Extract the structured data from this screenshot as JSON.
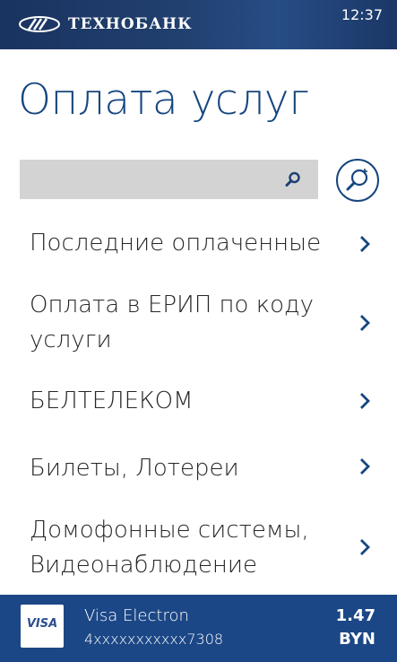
{
  "status_bar": {
    "bank_name": "ТЕХНОБАНК",
    "time": "12:37",
    "icons": [
      "bank-logo-icon"
    ]
  },
  "page": {
    "title": "Оплата услуг"
  },
  "search": {
    "value": "",
    "placeholder": "",
    "search_icon": "search-icon",
    "advanced_search_icon": "advanced-search-icon"
  },
  "menu": {
    "items": [
      {
        "label": "Последние оплаченные",
        "icon": "chevron-right-icon"
      },
      {
        "label": "Оплата в ЕРИП по коду услуги",
        "icon": "chevron-right-icon"
      },
      {
        "label": "БЕЛТЕЛЕКОМ",
        "icon": "chevron-right-icon"
      },
      {
        "label": "Билеты, Лотереи",
        "icon": "chevron-right-icon"
      },
      {
        "label": "Домофонные системы, Видеонаблюдение",
        "icon": "chevron-right-icon"
      }
    ]
  },
  "card": {
    "logo_text": "VISA",
    "name": "Visa Electron",
    "number": "4xxxxxxxxxxx7308",
    "amount": "1.47",
    "currency": "BYN"
  },
  "colors": {
    "accent": "#16467f",
    "card_bar": "#1c4786",
    "status_bar": "#21406f",
    "search_bg": "#d3d3d3"
  }
}
